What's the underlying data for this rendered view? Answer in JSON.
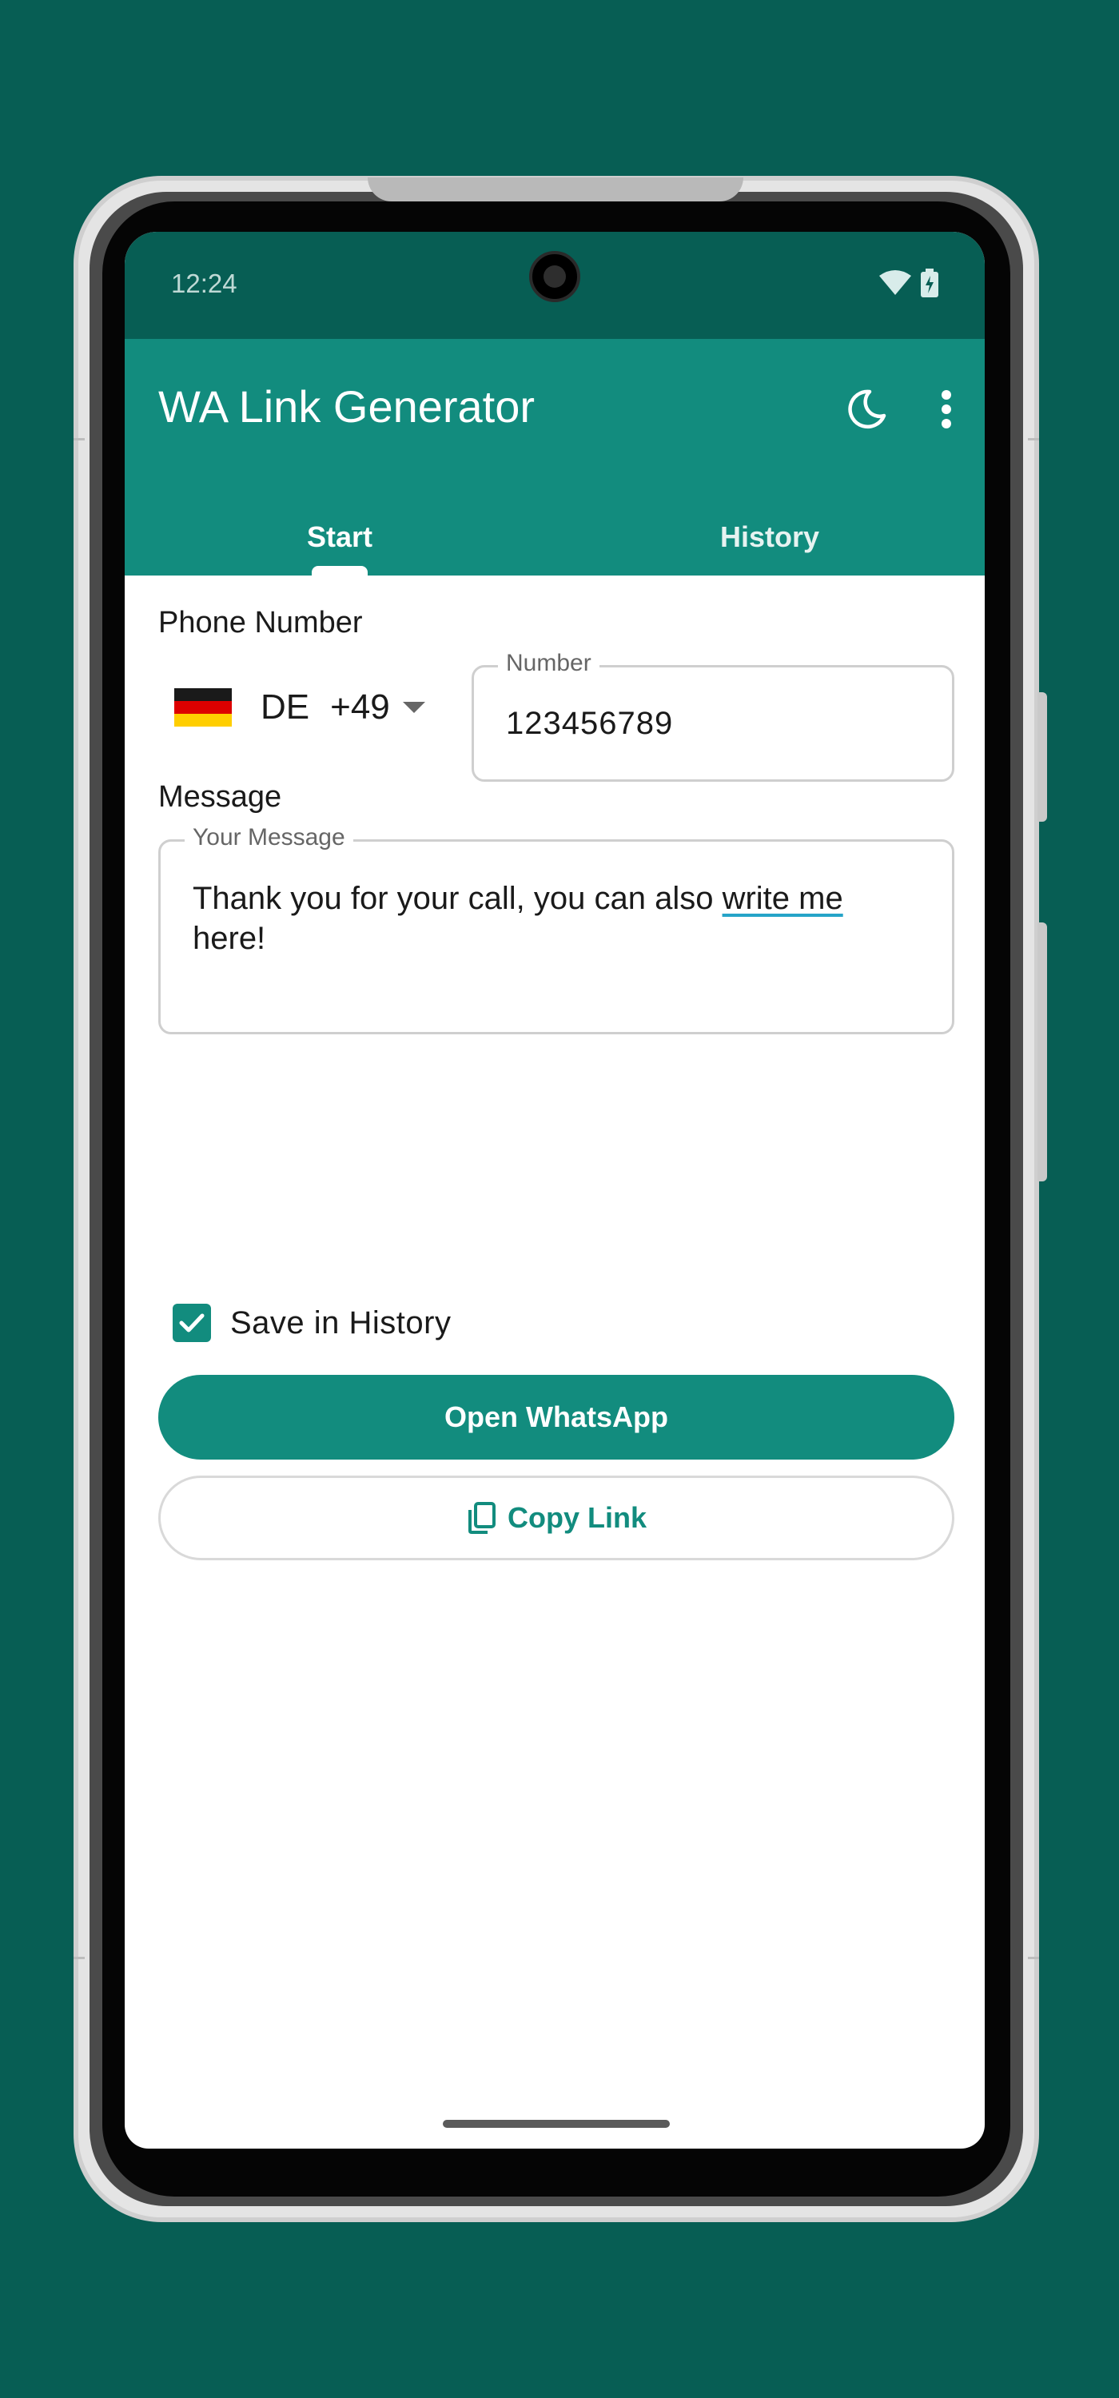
{
  "status_bar": {
    "time": "12:24"
  },
  "app_bar": {
    "title": "WA Link Generator"
  },
  "tabs": [
    {
      "label": "Start"
    },
    {
      "label": "History"
    }
  ],
  "phone_section": {
    "label": "Phone Number",
    "country_code": "DE",
    "dial_code": "+49",
    "number_field": {
      "label": "Number",
      "value": "123456789"
    }
  },
  "message_section": {
    "label": "Message",
    "message_field": {
      "label": "Your Message",
      "value_start": "Thank you for your call, you can also ",
      "value_underlined": "write me",
      "value_end": " here!"
    }
  },
  "save_history": {
    "label": "Save in History",
    "checked": true
  },
  "buttons": {
    "open_whatsapp": "Open WhatsApp",
    "copy_link": "Copy Link"
  },
  "colors": {
    "primary": "#128C7E",
    "primary_dark": "#075E54",
    "background": "#075E54"
  },
  "icons": [
    "wifi-icon",
    "battery-icon",
    "moon-icon",
    "more-vert-icon",
    "checkbox-checked-icon",
    "copy-icon"
  ]
}
